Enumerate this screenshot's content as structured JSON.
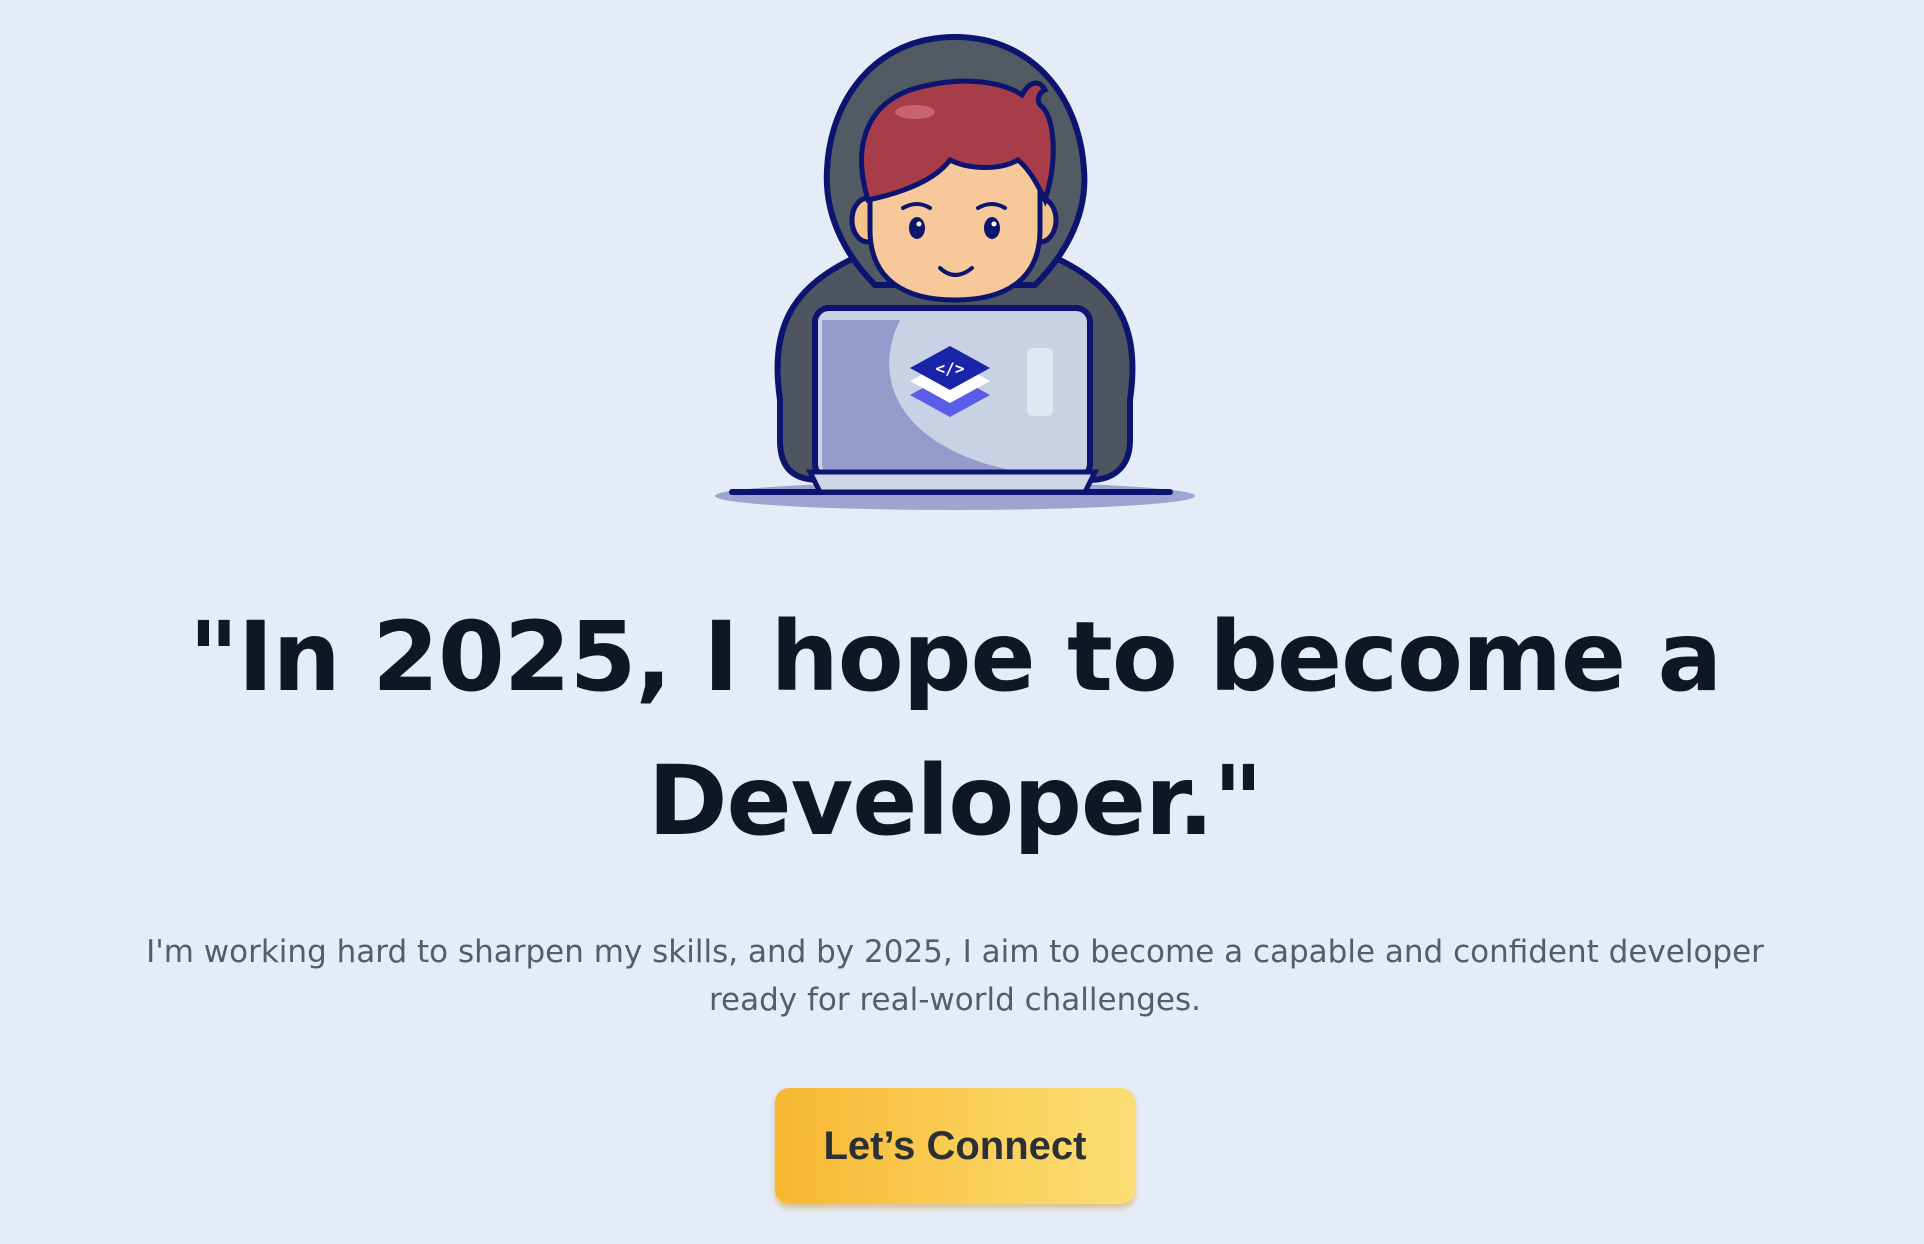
{
  "hero": {
    "illustration_icon": "developer-with-laptop-icon",
    "laptop_logo_icon": "code-layers-icon",
    "headline": "\"In 2025, I hope to become a Developer.\"",
    "subtext": "I'm working hard to sharpen my skills, and by 2025, I aim to become a capable and confident developer ready for real-world challenges.",
    "cta_label": "Let’s Connect"
  },
  "colors": {
    "background": "#e6ecf7",
    "headline": "#0f1626",
    "subtext": "#555c6b",
    "button_gradient_start": "#f7b731",
    "button_gradient_end": "#fbdd73",
    "button_text": "#2b2f36"
  }
}
